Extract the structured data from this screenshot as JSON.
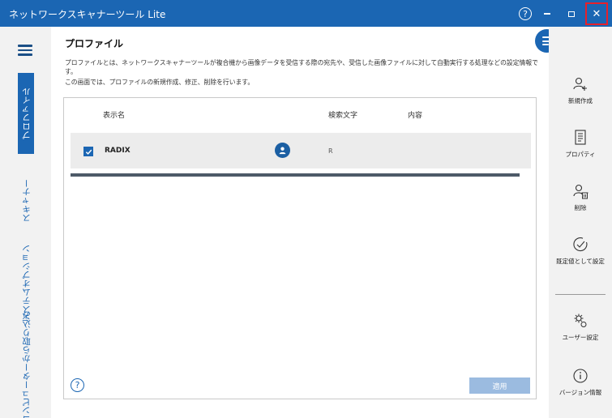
{
  "window": {
    "title": "ネットワークスキャナーツール Lite",
    "help_glyph": "?",
    "close_glyph": "✕"
  },
  "left_nav": {
    "menu_icon": "hamburger-icon",
    "tabs": [
      {
        "label": "プロファイル",
        "active": true
      },
      {
        "label": "スキャナー",
        "active": false
      },
      {
        "label": "システムオプション",
        "active": false
      },
      {
        "label": "コンピューターから取り込み",
        "active": false
      }
    ]
  },
  "main": {
    "title": "プロファイル",
    "description": "プロファイルとは、ネットワークスキャナーツールが複合機から画像データを受信する際の宛先や、受信した画像ファイルに対して自動実行する処理などの設定情報です。",
    "description2": "この画面では、プロファイルの新規作成、修正、削除を行います。",
    "table": {
      "columns": [
        "表示名",
        "検索文字",
        "内容"
      ],
      "rows": [
        {
          "checked": true,
          "name": "RADIX",
          "search": "R",
          "content": ""
        }
      ]
    },
    "help_glyph": "?",
    "apply_label": "適用"
  },
  "right_panel": {
    "menu_icon": "menu-lines-icon",
    "actions": [
      {
        "label": "新規作成",
        "icon": "add-user-icon"
      },
      {
        "label": "プロパティ",
        "icon": "properties-document-icon"
      },
      {
        "label": "削除",
        "icon": "delete-user-icon"
      },
      {
        "label": "既定値として設定",
        "icon": "check-circle-icon"
      },
      {
        "label": "ユーザー設定",
        "icon": "gear-settings-icon"
      },
      {
        "label": "バージョン情報",
        "icon": "info-icon"
      }
    ]
  },
  "colors": {
    "accent": "#1b66b3",
    "close_highlight": "#e8202a",
    "apply_disabled": "#9bbbe0"
  }
}
